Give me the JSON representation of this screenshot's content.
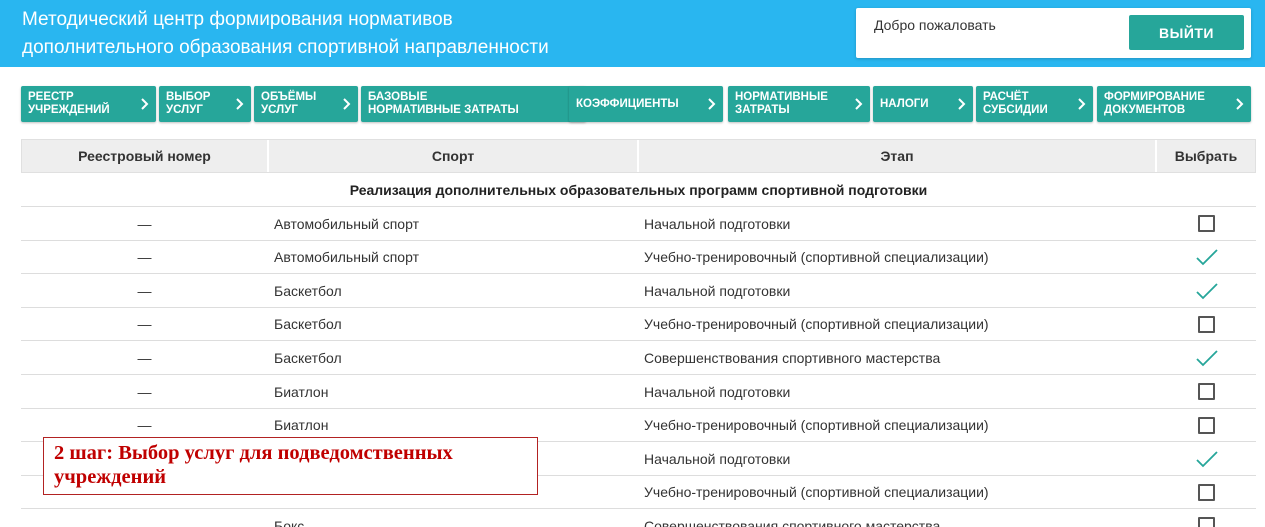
{
  "header": {
    "title_line1": "Методический центр формирования нормативов",
    "title_line2": "дополнительного образования спортивной направленности",
    "welcome": "Добро пожаловать",
    "logout_label": "ВЫЙТИ",
    "bg_color": "#29b6f0",
    "accent_color": "#26a69a"
  },
  "nav": {
    "items": [
      {
        "label": "РЕЕСТР\nУЧРЕЖДЕНИЙ",
        "icon": "chevron-right-icon"
      },
      {
        "label": "ВЫБОР\nУСЛУГ",
        "icon": "chevron-right-icon"
      },
      {
        "label": "ОБЪЁМЫ\nУСЛУГ",
        "icon": "chevron-right-icon"
      },
      {
        "label": "БАЗОВЫЕ\nНОРМАТИВНЫЕ ЗАТРАТЫ",
        "icon": "chevron-right-icon"
      },
      {
        "label": "КОЭФФИЦИЕНТЫ",
        "icon": "chevron-right-icon"
      },
      {
        "label": "НОРМАТИВНЫЕ\nЗАТРАТЫ",
        "icon": "chevron-right-icon"
      },
      {
        "label": "НАЛОГИ",
        "icon": "chevron-right-icon"
      },
      {
        "label": "РАСЧЁТ\nСУБСИДИИ",
        "icon": "chevron-right-icon"
      },
      {
        "label": "ФОРМИРОВАНИЕ\nДОКУМЕНТОВ",
        "icon": "chevron-right-icon"
      }
    ]
  },
  "table": {
    "columns": [
      "Реестровый номер",
      "Спорт",
      "Этап",
      "Выбрать"
    ],
    "group_title": "Реализация дополнительных образовательных программ спортивной подготовки",
    "rows": [
      {
        "reg": "—",
        "sport": "Автомобильный спорт",
        "stage": "Начальной подготовки",
        "selected": false
      },
      {
        "reg": "—",
        "sport": "Автомобильный спорт",
        "stage": "Учебно-тренировочный (спортивной специализации)",
        "selected": true
      },
      {
        "reg": "—",
        "sport": "Баскетбол",
        "stage": "Начальной подготовки",
        "selected": true
      },
      {
        "reg": "—",
        "sport": "Баскетбол",
        "stage": "Учебно-тренировочный (спортивной специализации)",
        "selected": false
      },
      {
        "reg": "—",
        "sport": "Баскетбол",
        "stage": "Совершенствования спортивного мастерства",
        "selected": true
      },
      {
        "reg": "—",
        "sport": "Биатлон",
        "stage": "Начальной подготовки",
        "selected": false
      },
      {
        "reg": "—",
        "sport": "Биатлон",
        "stage": "Учебно-тренировочный (спортивной специализации)",
        "selected": false
      },
      {
        "reg": "",
        "sport": "",
        "stage": "Начальной подготовки",
        "selected": true
      },
      {
        "reg": "",
        "sport": "",
        "stage": "Учебно-тренировочный (спортивной специализации)",
        "selected": false
      },
      {
        "reg": "—",
        "sport": "Бокс",
        "stage": "Совершенствования спортивного мастерства",
        "selected": false
      }
    ]
  },
  "annotation": {
    "text": "2 шаг: Выбор услуг для подведомственных учреждений",
    "color": "#c00000"
  }
}
